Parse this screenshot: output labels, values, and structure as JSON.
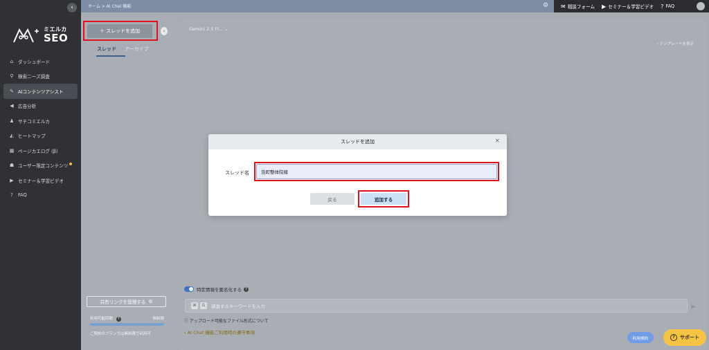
{
  "sidebar": {
    "logo": {
      "ja": "ミエルカ",
      "en": "SEO"
    },
    "collapse_icon": "‹",
    "items": [
      {
        "label": "ダッシュボード",
        "icon": "home-icon",
        "glyph": "⌂"
      },
      {
        "label": "検索ニーズ調査",
        "icon": "search-icon",
        "glyph": "⚲"
      },
      {
        "label": "AIコンテンツアシスト",
        "icon": "wand-icon",
        "glyph": "✎"
      },
      {
        "label": "広告分析",
        "icon": "megaphone-icon",
        "glyph": "◀"
      },
      {
        "label": "サチコミエルカ",
        "icon": "people-icon",
        "glyph": "♟"
      },
      {
        "label": "ヒートマップ",
        "icon": "heatmap-icon",
        "glyph": "◭"
      },
      {
        "label": "ページカエログ (β)",
        "icon": "page-icon",
        "glyph": "▦"
      },
      {
        "label": "ユーザー限定コンテンツ",
        "icon": "users-icon",
        "glyph": "☗"
      },
      {
        "label": "セミナー＆学習ビデオ",
        "icon": "video-icon",
        "glyph": "▶"
      },
      {
        "label": "FAQ",
        "icon": "question-icon",
        "glyph": "?"
      }
    ]
  },
  "topbar": {
    "breadcrumb": "ホーム > AI Chat 機能",
    "gear_glyph": "⚙",
    "links": [
      {
        "label": "相談フォーム",
        "glyph": "✉"
      },
      {
        "label": "セミナー＆学習ビデオ",
        "glyph": "▶"
      },
      {
        "label": "FAQ",
        "glyph": "?"
      }
    ]
  },
  "thread_panel": {
    "add_button": "＋ スレッドを追加",
    "toggle_glyph": "‹",
    "tabs": [
      "スレッド",
      "アーカイブ"
    ],
    "share_link_button": "共有リンクを管理する",
    "share_glyph": "⚙",
    "quota_label": "利用可能回数",
    "quota_value": "無制限",
    "quota_fill": 1.0,
    "quota_note": "ご契約のプランでは無制限で利用可"
  },
  "main": {
    "model": "Gemini 2.5 Fl...",
    "template_link": "‹ テンプレートを表示",
    "anonymize_label": "特定情報を匿名化する",
    "input_placeholder": "調査するキーワードを入力",
    "send_glyph": "➤",
    "file_note": "アップロード可能なファイル形式について",
    "terms_note": "AI Chat 機能ご利用時の遵守事項"
  },
  "modal": {
    "title": "スレッドを追加",
    "close_glyph": "×",
    "field_label": "スレッド名",
    "field_value": "茨町整体院様",
    "back_button": "戻る",
    "submit_button": "追加する"
  },
  "floating": {
    "usage_terms": "利用規約",
    "support": "サポート"
  },
  "colors": {
    "highlight": "#e0101a",
    "accent": "#3e72c4",
    "support": "#f5c445"
  }
}
